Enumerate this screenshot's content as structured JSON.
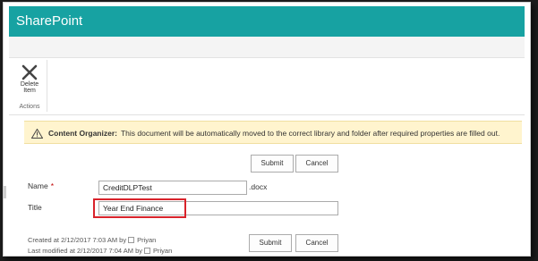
{
  "app": {
    "title": "SharePoint"
  },
  "ribbon": {
    "delete_label_line1": "Delete",
    "delete_label_line2": "Item",
    "group_label": "Actions"
  },
  "notice": {
    "heading": "Content Organizer:",
    "text": "This document will be automatically moved to the correct library and folder after required properties are filled out."
  },
  "buttons": {
    "submit": "Submit",
    "cancel": "Cancel"
  },
  "form": {
    "name_label": "Name",
    "required_mark": "*",
    "name_value": "CreditDLPTest",
    "name_extension": ".docx",
    "title_label": "Title",
    "title_value": "Year End Finance"
  },
  "meta": {
    "created_prefix": "Created at 2/12/2017 7:03 AM  by",
    "created_by": "Priyan",
    "modified_prefix": "Last modified at 2/12/2017 7:04 AM  by",
    "modified_by": "Priyan"
  },
  "colors": {
    "suitebar": "#17a2a2",
    "notice_bg": "#fff4ce",
    "highlight": "#d9232b"
  }
}
